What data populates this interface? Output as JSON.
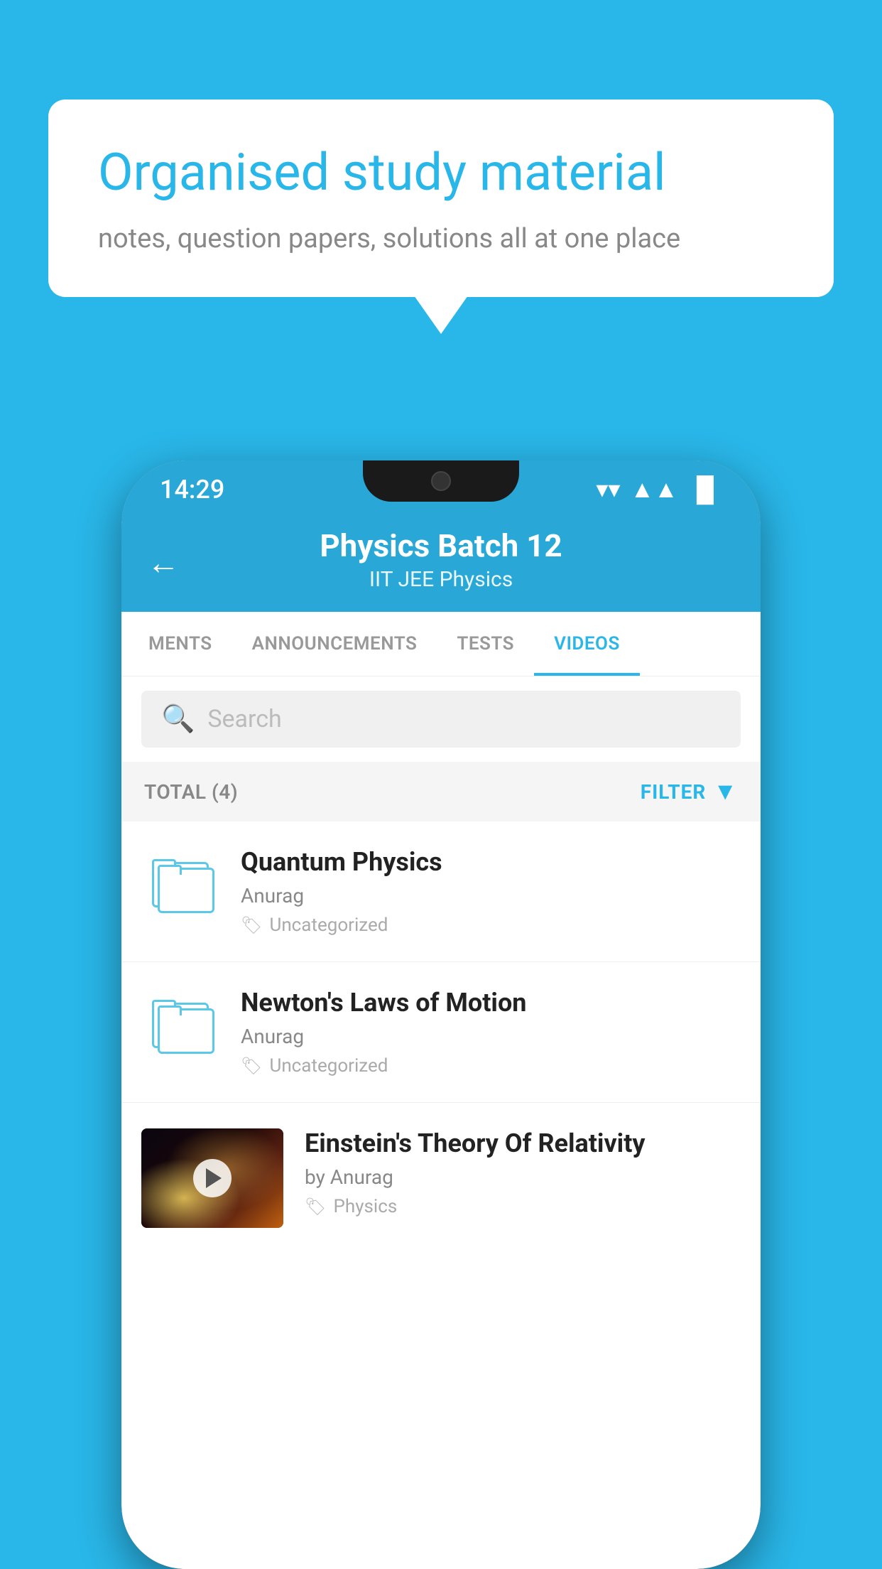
{
  "background_color": "#29b6e8",
  "speech_bubble": {
    "title": "Organised study material",
    "subtitle": "notes, question papers, solutions all at one place"
  },
  "status_bar": {
    "time": "14:29",
    "wifi": "▼",
    "signal": "▲",
    "battery": "▐"
  },
  "header": {
    "back_label": "←",
    "title": "Physics Batch 12",
    "subtitle_part1": "IIT JEE",
    "subtitle_separator": "   ",
    "subtitle_part2": "Physics"
  },
  "tabs": [
    {
      "label": "MENTS",
      "active": false
    },
    {
      "label": "ANNOUNCEMENTS",
      "active": false
    },
    {
      "label": "TESTS",
      "active": false
    },
    {
      "label": "VIDEOS",
      "active": true
    }
  ],
  "search": {
    "placeholder": "Search"
  },
  "filter_bar": {
    "total_label": "TOTAL (4)",
    "filter_label": "FILTER"
  },
  "video_items": [
    {
      "title": "Quantum Physics",
      "author": "Anurag",
      "tag": "Uncategorized",
      "has_thumbnail": false
    },
    {
      "title": "Newton's Laws of Motion",
      "author": "Anurag",
      "tag": "Uncategorized",
      "has_thumbnail": false
    },
    {
      "title": "Einstein's Theory Of Relativity",
      "author": "by Anurag",
      "tag": "Physics",
      "has_thumbnail": true
    }
  ]
}
